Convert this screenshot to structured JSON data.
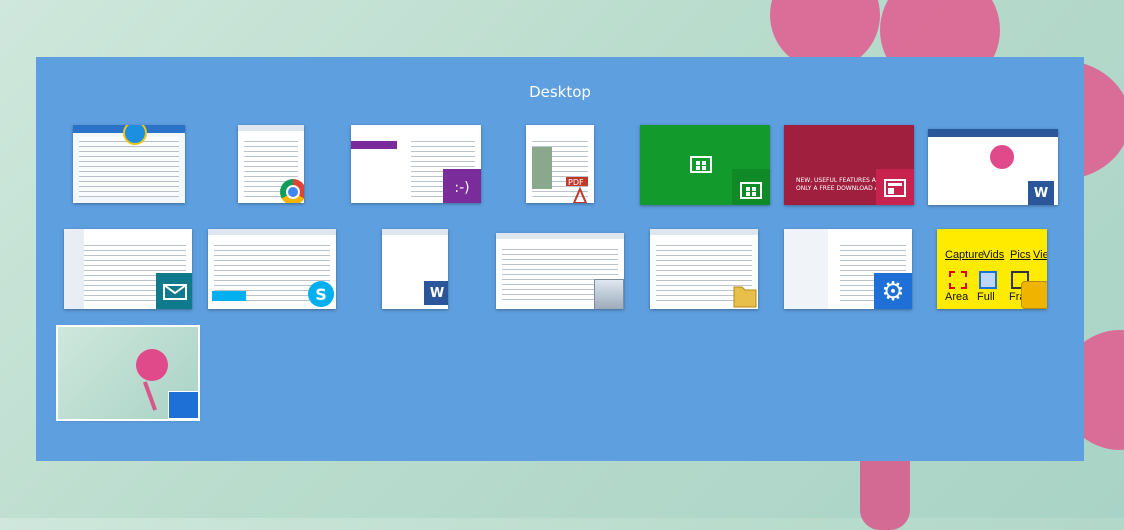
{
  "switcher": {
    "title": "Desktop"
  },
  "windows": [
    {
      "name": "window-ie",
      "icon": "ie-icon"
    },
    {
      "name": "window-chrome",
      "icon": "chrome-icon"
    },
    {
      "name": "window-onenote-feedback",
      "icon": "feedback-icon"
    },
    {
      "name": "window-pdf",
      "icon": "pdf-icon"
    },
    {
      "name": "window-store",
      "icon": "store-icon"
    },
    {
      "name": "window-news",
      "icon": "news-icon",
      "text": "NEW, USEFUL FEATURES ARE\nONLY A FREE DOWNLOAD AW"
    },
    {
      "name": "window-word-flower",
      "icon": "word-icon"
    },
    {
      "name": "window-mail",
      "icon": "mail-icon"
    },
    {
      "name": "window-skype",
      "icon": "skype-icon"
    },
    {
      "name": "window-word-blank",
      "icon": "word-icon"
    },
    {
      "name": "window-control-panel",
      "icon": "control-panel-icon"
    },
    {
      "name": "window-file-explorer",
      "icon": "folder-icon"
    },
    {
      "name": "window-pc-settings",
      "icon": "gear-icon"
    },
    {
      "name": "window-snip-tool",
      "icon": "camera-icon",
      "menu": [
        "Capture",
        "Vids",
        "Pics",
        "Vie"
      ],
      "buttons": [
        "Area",
        "Full",
        "Fran"
      ]
    },
    {
      "name": "window-desktop",
      "icon": "desktop-icon",
      "selected": true
    }
  ]
}
